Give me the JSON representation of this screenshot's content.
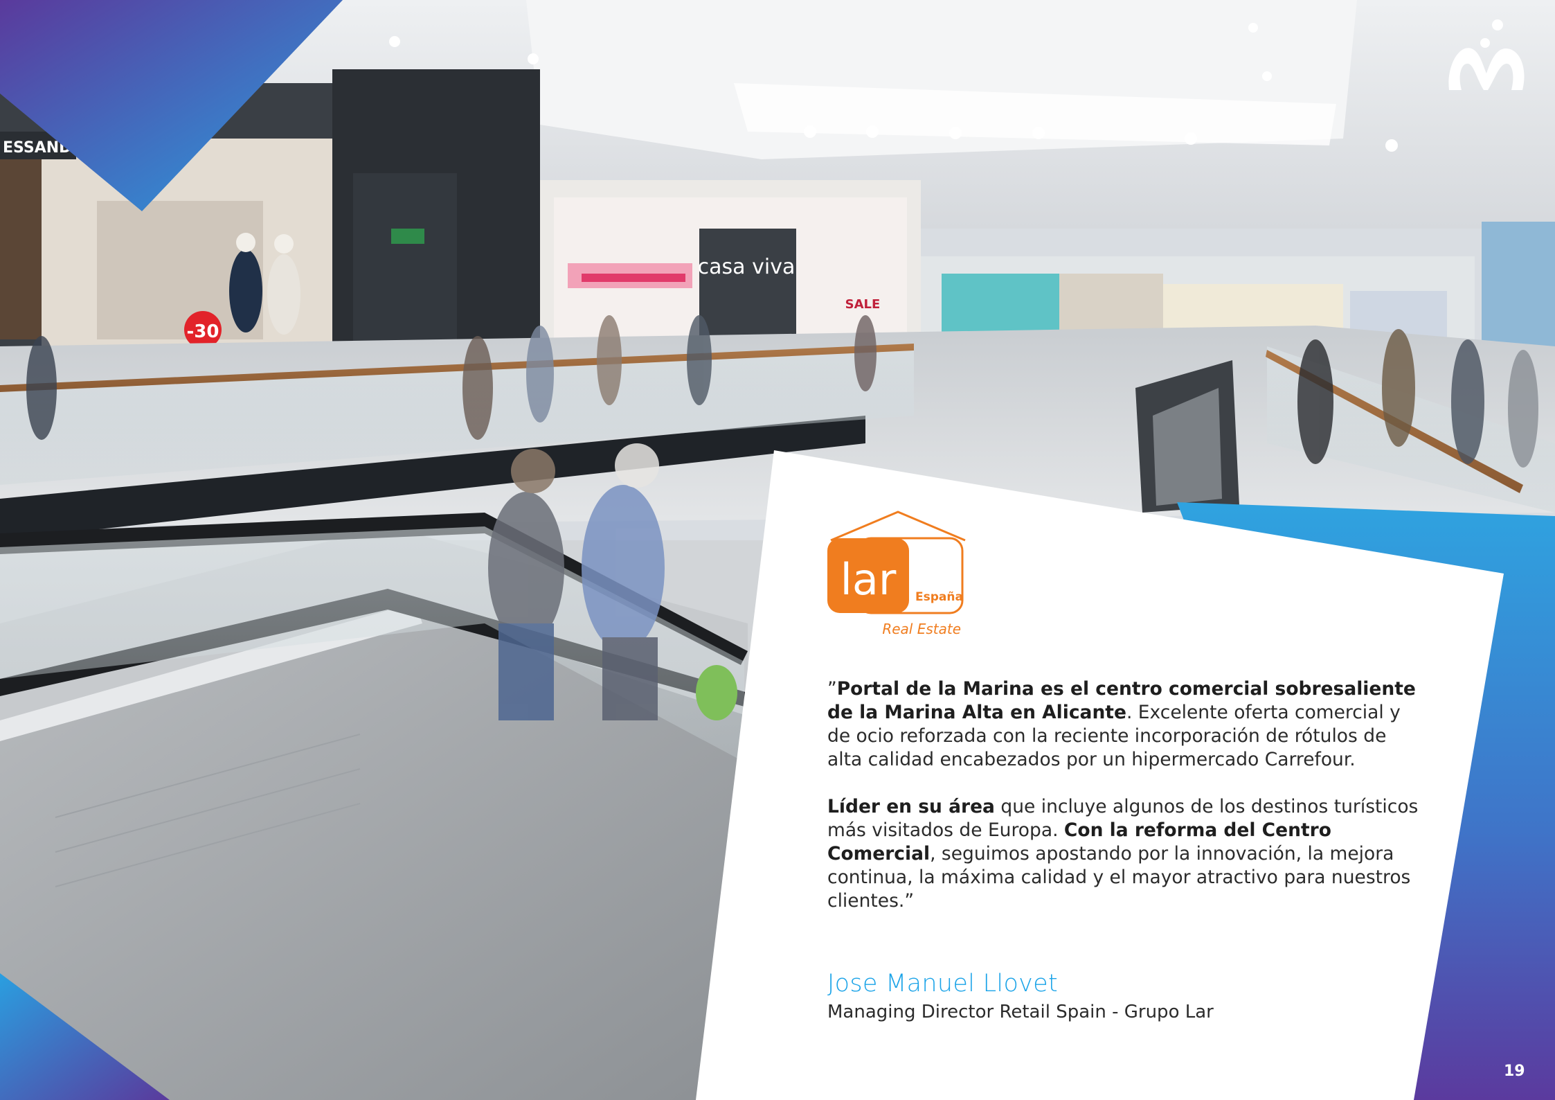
{
  "photo": {
    "store_sign_left": "ESSANDR",
    "store_sign_casaviva": "casa viva",
    "discount_tag": "-30",
    "sale_tag": "SALE"
  },
  "logo_lar": {
    "wordmark": "lar",
    "country": "España",
    "tagline": "Real Estate",
    "color": "#f07d1f"
  },
  "quote": {
    "open_mark": "”",
    "p1_bold": "Portal de la Marina es el centro comercial sobresaliente de la Marina Alta en Alicante",
    "p1_rest": ". Excelente oferta comercial y de ocio reforzada con la reciente incorporación de rótulos de alta calidad encabezados por un hipermercado Carrefour.",
    "p2_bold_1": "Líder en su área",
    "p2_text_1": " que incluye algunos de los destinos turísticos más visitados de Europa. ",
    "p2_bold_2": "Con la reforma del Centro Comercial",
    "p2_text_2": ", seguimos apostando por la innovación, la mejora continua, la máxima calidad y el mayor atractivo para nuestros clientes.”"
  },
  "author": {
    "name": "Jose Manuel Llovet",
    "role": "Managing Director Retail Spain - Grupo Lar"
  },
  "page": {
    "number": "19"
  },
  "colors": {
    "gradient_blue": "#2a9fe0",
    "gradient_purple": "#5a3a9c",
    "author_blue": "#1aa3e8"
  },
  "icons": {
    "brand": "mall-brand-logo-icon"
  }
}
